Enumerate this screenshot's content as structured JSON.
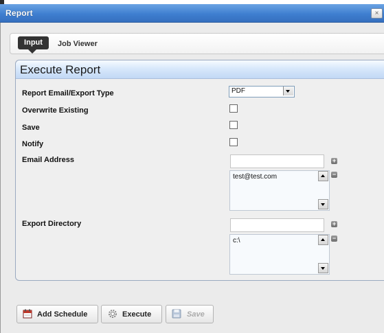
{
  "window": {
    "title": "Report",
    "close_glyph": "×"
  },
  "tabs": [
    {
      "label": "Input",
      "active": true
    },
    {
      "label": "Job Viewer",
      "active": false
    }
  ],
  "section": {
    "title": "Execute Report",
    "fields": {
      "export_type": {
        "label": "Report Email/Export Type",
        "value": "PDF"
      },
      "overwrite": {
        "label": "Overwrite Existing",
        "checked": false
      },
      "save": {
        "label": "Save",
        "checked": false
      },
      "notify": {
        "label": "Notify",
        "checked": false
      },
      "email": {
        "label": "Email Address",
        "input_value": "",
        "list": [
          "test@test.com"
        ]
      },
      "export_dir": {
        "label": "Export Directory",
        "input_value": "",
        "list": [
          "c:\\"
        ]
      }
    }
  },
  "buttons": {
    "add_schedule": "Add Schedule",
    "execute": "Execute",
    "save": "Save"
  },
  "colors": {
    "titlebar": "#3f7fd0",
    "panel_header": "#c2d8f5",
    "active_tab": "#333333",
    "calendar_icon": "#c0392b"
  }
}
